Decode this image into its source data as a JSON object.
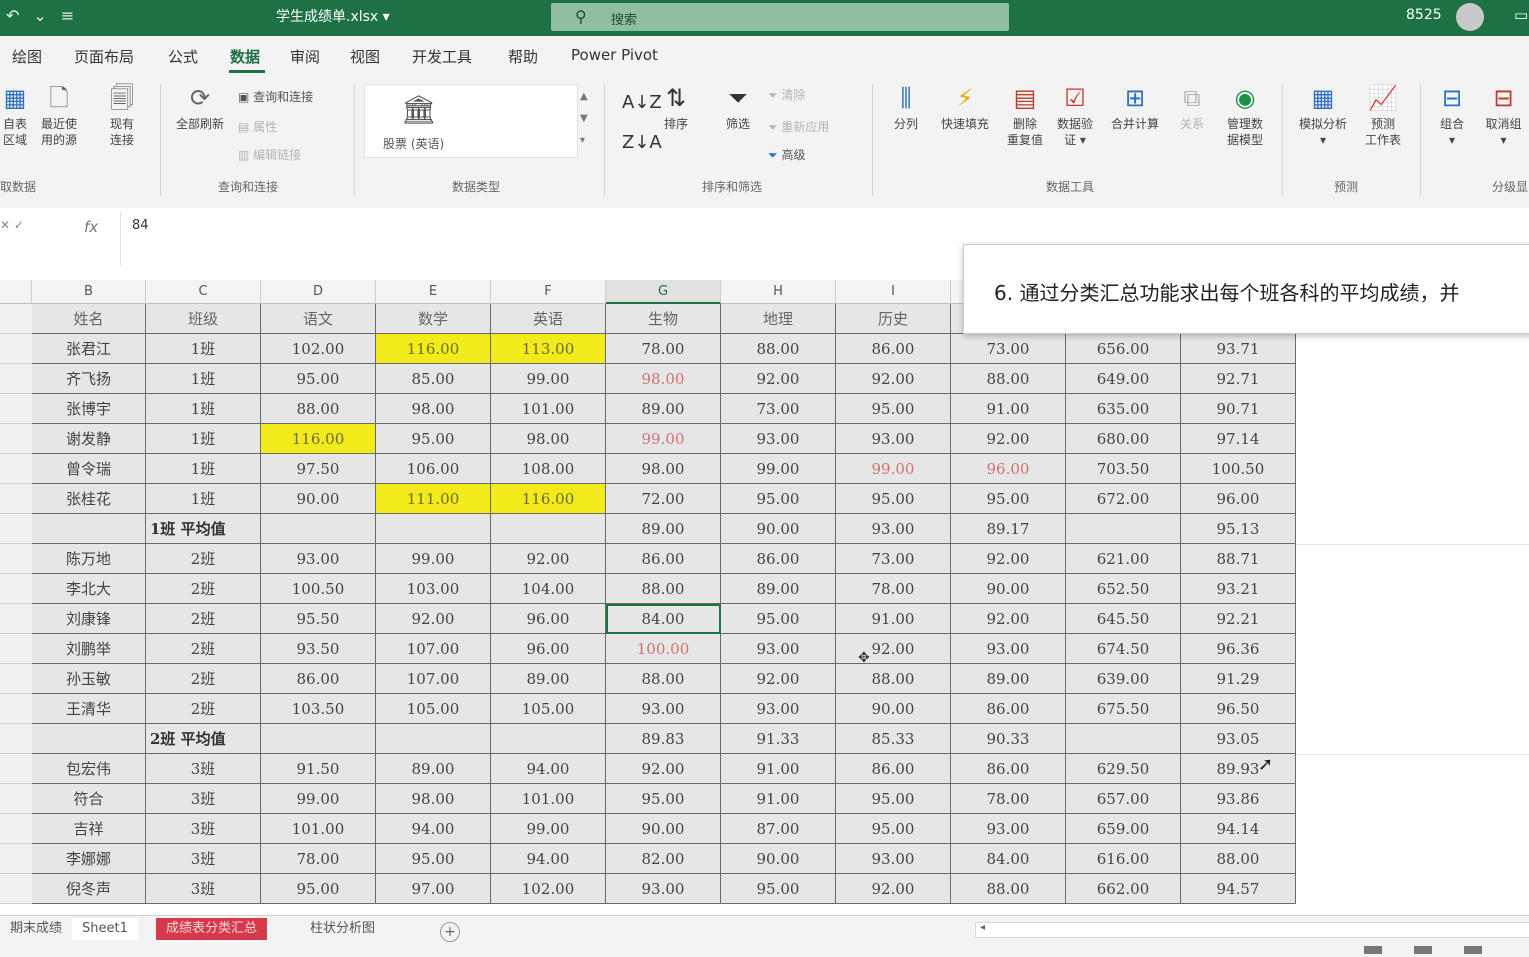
{
  "titlebar": {
    "undo_icon": "undo-icon",
    "qat_more": "≡",
    "filename": "学生成绩单.xlsx ▾",
    "search_placeholder": "搜索",
    "user": "8525"
  },
  "tabs": [
    "绘图",
    "页面布局",
    "公式",
    "数据",
    "审阅",
    "视图",
    "开发工具",
    "帮助",
    "Power Pivot"
  ],
  "active_tab": "数据",
  "ribbon": {
    "get_data": {
      "btn_from_table": "自表\n区域",
      "btn_recent": "最近使\n用的源",
      "btn_existing": "现有\n连接",
      "group": "取数据"
    },
    "queries": {
      "btn_refresh_all": "全部刷新",
      "query_conn": "查询和连接",
      "props": "属性",
      "edit_links": "编辑链接",
      "group": "查询和连接"
    },
    "data_types": {
      "stocks": "股票 (英语)",
      "group": "数据类型"
    },
    "sort_filter": {
      "sort": "排序",
      "filter": "筛选",
      "clear": "清除",
      "reapply": "重新应用",
      "advanced": "高级",
      "group": "排序和筛选"
    },
    "data_tools": {
      "text_to_columns": "分列",
      "flash_fill": "快速填充",
      "remove_dup": "删除\n重复值",
      "validation": "数据验\n证 ▾",
      "consolidate": "合并计算",
      "relationships": "关系",
      "manage_model": "管理数\n据模型",
      "group": "数据工具"
    },
    "forecast": {
      "what_if": "模拟分析\n▾",
      "forecast_sheet": "预测\n工作表",
      "group": "预测"
    },
    "outline": {
      "group_btn": "组合\n▾",
      "ungroup_btn": "取消组\n▾",
      "group": "分级显"
    }
  },
  "formula_bar": {
    "name_box": "✕ ✓",
    "fx": "fx",
    "value": "84"
  },
  "columns": [
    "B",
    "C",
    "D",
    "E",
    "F",
    "G",
    "H",
    "I",
    "",
    "",
    ""
  ],
  "selected_column": "G",
  "header_row": [
    "姓名",
    "班级",
    "语文",
    "数学",
    "英语",
    "生物",
    "地理",
    "历史",
    "",
    "",
    ""
  ],
  "rows": [
    {
      "cells": [
        "张君江",
        "1班",
        "102.00",
        "116.00",
        "113.00",
        "78.00",
        "88.00",
        "86.00",
        "73.00",
        "656.00",
        "93.71"
      ],
      "yellow": [
        3,
        4
      ],
      "red": []
    },
    {
      "cells": [
        "齐飞扬",
        "1班",
        "95.00",
        "85.00",
        "99.00",
        "98.00",
        "92.00",
        "92.00",
        "88.00",
        "649.00",
        "92.71"
      ],
      "yellow": [],
      "red": [
        5
      ]
    },
    {
      "cells": [
        "张博宇",
        "1班",
        "88.00",
        "98.00",
        "101.00",
        "89.00",
        "73.00",
        "95.00",
        "91.00",
        "635.00",
        "90.71"
      ],
      "yellow": [],
      "red": []
    },
    {
      "cells": [
        "谢发静",
        "1班",
        "116.00",
        "95.00",
        "98.00",
        "99.00",
        "93.00",
        "93.00",
        "92.00",
        "680.00",
        "97.14"
      ],
      "yellow": [
        2
      ],
      "red": [
        5
      ]
    },
    {
      "cells": [
        "曾令瑞",
        "1班",
        "97.50",
        "106.00",
        "108.00",
        "98.00",
        "99.00",
        "99.00",
        "96.00",
        "703.50",
        "100.50"
      ],
      "yellow": [],
      "red": [
        7,
        8
      ]
    },
    {
      "cells": [
        "张桂花",
        "1班",
        "90.00",
        "111.00",
        "116.00",
        "72.00",
        "95.00",
        "95.00",
        "95.00",
        "672.00",
        "96.00"
      ],
      "yellow": [
        3,
        4
      ],
      "red": []
    },
    {
      "cells": [
        "",
        "1班 平均值",
        "",
        "",
        "",
        "89.00",
        "90.00",
        "93.00",
        "89.17",
        "",
        "95.13"
      ],
      "yellow": [],
      "red": [],
      "subtotal": true
    },
    {
      "cells": [
        "陈万地",
        "2班",
        "93.00",
        "99.00",
        "92.00",
        "86.00",
        "86.00",
        "73.00",
        "92.00",
        "621.00",
        "88.71"
      ],
      "yellow": [],
      "red": []
    },
    {
      "cells": [
        "李北大",
        "2班",
        "100.50",
        "103.00",
        "104.00",
        "88.00",
        "89.00",
        "78.00",
        "90.00",
        "652.50",
        "93.21"
      ],
      "yellow": [],
      "red": []
    },
    {
      "cells": [
        "刘康锋",
        "2班",
        "95.50",
        "92.00",
        "96.00",
        "84.00",
        "95.00",
        "91.00",
        "92.00",
        "645.50",
        "92.21"
      ],
      "yellow": [],
      "red": [],
      "active_col": 5
    },
    {
      "cells": [
        "刘鹏举",
        "2班",
        "93.50",
        "107.00",
        "96.00",
        "100.00",
        "93.00",
        "92.00",
        "93.00",
        "674.50",
        "96.36"
      ],
      "yellow": [],
      "red": [
        5
      ]
    },
    {
      "cells": [
        "孙玉敏",
        "2班",
        "86.00",
        "107.00",
        "89.00",
        "88.00",
        "92.00",
        "88.00",
        "89.00",
        "639.00",
        "91.29"
      ],
      "yellow": [],
      "red": []
    },
    {
      "cells": [
        "王清华",
        "2班",
        "103.50",
        "105.00",
        "105.00",
        "93.00",
        "93.00",
        "90.00",
        "86.00",
        "675.50",
        "96.50"
      ],
      "yellow": [],
      "red": []
    },
    {
      "cells": [
        "",
        "2班 平均值",
        "",
        "",
        "",
        "89.83",
        "91.33",
        "85.33",
        "90.33",
        "",
        "93.05"
      ],
      "yellow": [],
      "red": [],
      "subtotal": true
    },
    {
      "cells": [
        "包宏伟",
        "3班",
        "91.50",
        "89.00",
        "94.00",
        "92.00",
        "91.00",
        "86.00",
        "86.00",
        "629.50",
        "89.93"
      ],
      "yellow": [],
      "red": []
    },
    {
      "cells": [
        "符合",
        "3班",
        "99.00",
        "98.00",
        "101.00",
        "95.00",
        "91.00",
        "95.00",
        "78.00",
        "657.00",
        "93.86"
      ],
      "yellow": [],
      "red": []
    },
    {
      "cells": [
        "吉祥",
        "3班",
        "101.00",
        "94.00",
        "99.00",
        "90.00",
        "87.00",
        "95.00",
        "93.00",
        "659.00",
        "94.14"
      ],
      "yellow": [],
      "red": []
    },
    {
      "cells": [
        "李娜娜",
        "3班",
        "78.00",
        "95.00",
        "94.00",
        "82.00",
        "90.00",
        "93.00",
        "84.00",
        "616.00",
        "88.00"
      ],
      "yellow": [],
      "red": []
    },
    {
      "cells": [
        "倪冬声",
        "3班",
        "95.00",
        "97.00",
        "102.00",
        "93.00",
        "95.00",
        "92.00",
        "88.00",
        "662.00",
        "94.57"
      ],
      "yellow": [],
      "red": []
    }
  ],
  "note": "6. 通过分类汇总功能求出每个班各科的平均成绩，并",
  "sheet_tabs": [
    "期末成绩",
    "Sheet1",
    "成绩表分类汇总",
    "柱状分析图"
  ],
  "active_sheet": "成绩表分类汇总",
  "colors": {
    "accent": "#1e7145",
    "highlight": "#f2ea1a",
    "active_sheet_tab": "#d53a4a"
  }
}
